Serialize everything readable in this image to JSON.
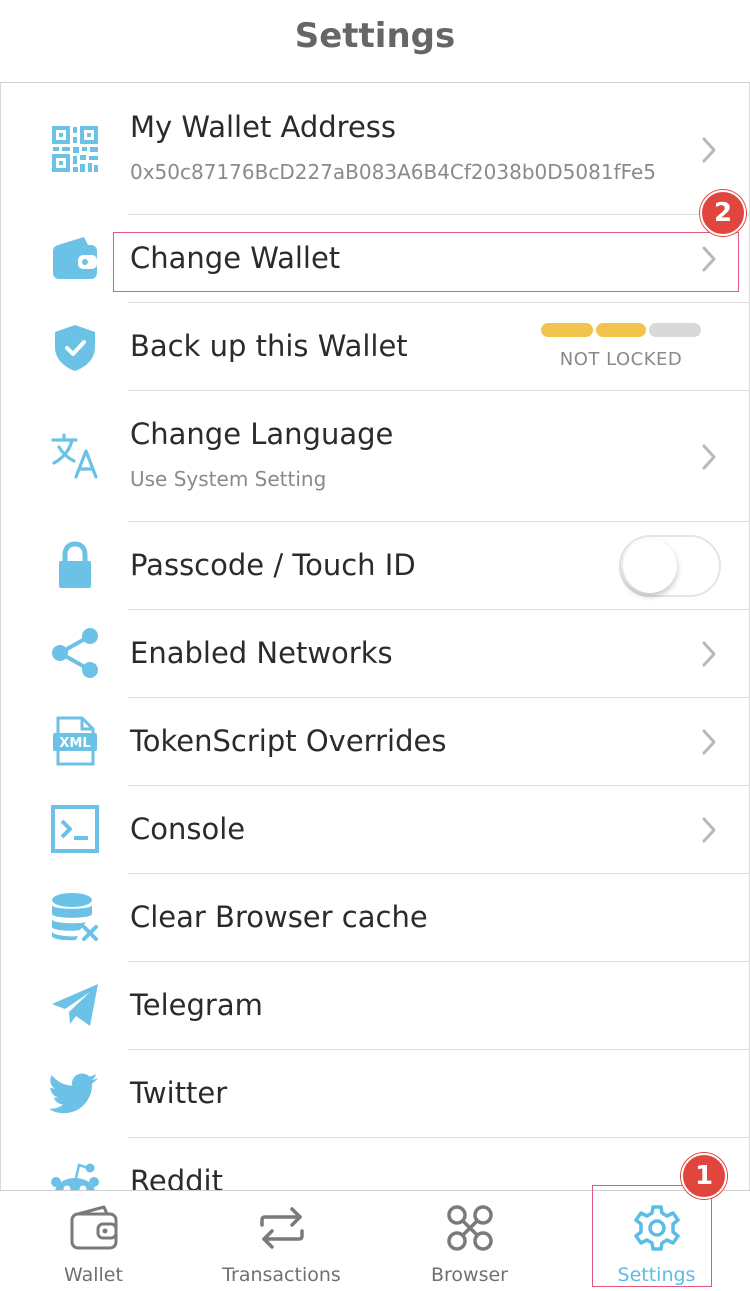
{
  "header": {
    "title": "Settings"
  },
  "colors": {
    "accent": "#5bbde6",
    "icon_blue": "#6cc2e6",
    "badge_red": "#e0463d",
    "highlight_pink": "#e2577a",
    "strength_yellow": "#f3c44b",
    "strength_gray": "#d9d9d9"
  },
  "settings": {
    "wallet_address": {
      "label": "My Wallet Address",
      "value": "0x50c87176BcD227aB083A6B4Cf2038b0D5081fFe5",
      "icon": "qr-code-icon"
    },
    "change_wallet": {
      "label": "Change Wallet",
      "icon": "wallet-icon"
    },
    "backup": {
      "label": "Back up this Wallet",
      "status": "NOT LOCKED",
      "strength_filled": 2,
      "strength_total": 3,
      "icon": "shield-check-icon"
    },
    "language": {
      "label": "Change Language",
      "value": "Use System Setting",
      "icon": "translate-icon"
    },
    "passcode": {
      "label": "Passcode / Touch ID",
      "enabled": false,
      "icon": "lock-icon"
    },
    "networks": {
      "label": "Enabled Networks",
      "icon": "share-network-icon"
    },
    "tokenscript": {
      "label": "TokenScript Overrides",
      "icon": "xml-file-icon"
    },
    "console": {
      "label": "Console",
      "icon": "terminal-icon"
    },
    "clear_cache": {
      "label": "Clear Browser cache",
      "icon": "database-clear-icon"
    },
    "telegram": {
      "label": "Telegram",
      "icon": "telegram-icon"
    },
    "twitter": {
      "label": "Twitter",
      "icon": "twitter-icon"
    },
    "reddit": {
      "label": "Reddit",
      "icon": "reddit-icon"
    }
  },
  "tabbar": {
    "tabs": [
      {
        "label": "Wallet",
        "icon": "wallet-tab-icon",
        "active": false
      },
      {
        "label": "Transactions",
        "icon": "transfer-arrows-icon",
        "active": false
      },
      {
        "label": "Browser",
        "icon": "browser-nodes-icon",
        "active": false
      },
      {
        "label": "Settings",
        "icon": "gear-icon",
        "active": true
      }
    ]
  },
  "annotations": {
    "badge_1": "1",
    "badge_2": "2"
  }
}
